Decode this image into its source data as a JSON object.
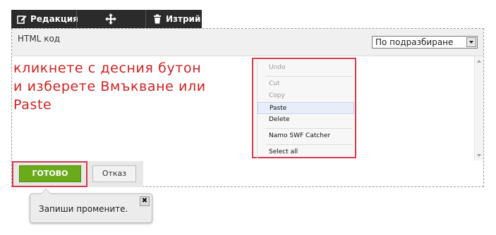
{
  "toolbar": {
    "edit_label": "Редакция",
    "delete_label": "Изтрий",
    "icons": {
      "edit": "edit-icon",
      "move": "move-icon",
      "delete": "trash-icon"
    }
  },
  "editor": {
    "header_label": "HTML код",
    "mode_select": {
      "selected": "По подразбиране"
    },
    "instructions": [
      "кликнете с десния бутон",
      "и изберете Вмъкване или",
      "Paste"
    ]
  },
  "context_menu": {
    "items": [
      {
        "label": "Undo",
        "state": "disabled"
      },
      {
        "label": "Cut",
        "state": "disabled"
      },
      {
        "label": "Copy",
        "state": "disabled"
      },
      {
        "label": "Paste",
        "state": "active"
      },
      {
        "label": "Delete",
        "state": "enabled"
      },
      {
        "label": "Namo SWF Catcher",
        "state": "enabled"
      },
      {
        "label": "Select all",
        "state": "enabled"
      }
    ]
  },
  "footer": {
    "done_label": "ГОТОВО",
    "cancel_label": "Отказ"
  },
  "tooltip": {
    "text": "Запиши промените.",
    "close_glyph": "✖"
  },
  "colors": {
    "highlight": "#d43a4a",
    "done_green": "#6aab1a",
    "instruction_red": "#cc2222",
    "toolbar_bg": "#2b2b2b"
  }
}
